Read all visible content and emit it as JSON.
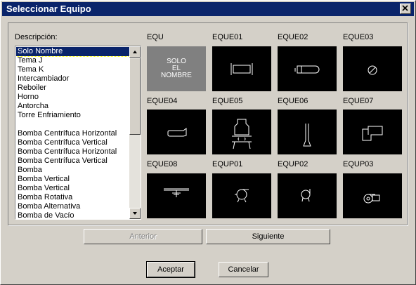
{
  "window": {
    "title": "Seleccionar Equipo",
    "close_glyph": "✕"
  },
  "description_label": "Descripción:",
  "list_items": [
    "Solo Nombre",
    "Tema J",
    "Tema K",
    "Intercambiador",
    "Reboiler",
    "Horno",
    "Antorcha",
    "Torre Enfriamiento",
    "",
    "Bomba Centrífuca Horizontal",
    "Bomba Centrífuca Vertical",
    "Bomba Centrífuca Horizontal",
    "Bomba Centrífuca Vertical",
    "Bomba",
    "Bomba Vertical",
    "Bomba Vertical",
    "Bomba Rotativa",
    "Bomba Alternativa",
    "Bomba de Vacío"
  ],
  "selected_index": 0,
  "equipment": [
    {
      "code": "EQU",
      "icon": "solo-nombre-icon",
      "text": [
        "SOLO",
        "EL",
        "NOMBRE"
      ]
    },
    {
      "code": "EQUE01",
      "icon": "heat-exchanger-icon"
    },
    {
      "code": "EQUE02",
      "icon": "reboiler-icon"
    },
    {
      "code": "EQUE03",
      "icon": "round-exchanger-icon"
    },
    {
      "code": "EQUE04",
      "icon": "vessel-icon"
    },
    {
      "code": "EQUE05",
      "icon": "furnace-icon"
    },
    {
      "code": "EQUE06",
      "icon": "flare-icon"
    },
    {
      "code": "EQUE07",
      "icon": "cooling-tower-icon"
    },
    {
      "code": "EQUE08",
      "icon": "horizontal-pump-icon"
    },
    {
      "code": "EQUP01",
      "icon": "centrifugal-pump-icon"
    },
    {
      "code": "EQUP02",
      "icon": "centrifugal-pump-vertical-icon"
    },
    {
      "code": "EQUP03",
      "icon": "pump-with-motor-icon"
    }
  ],
  "buttons": {
    "previous": "Anterior",
    "next": "Siguiente",
    "accept": "Aceptar",
    "cancel": "Cancelar"
  }
}
